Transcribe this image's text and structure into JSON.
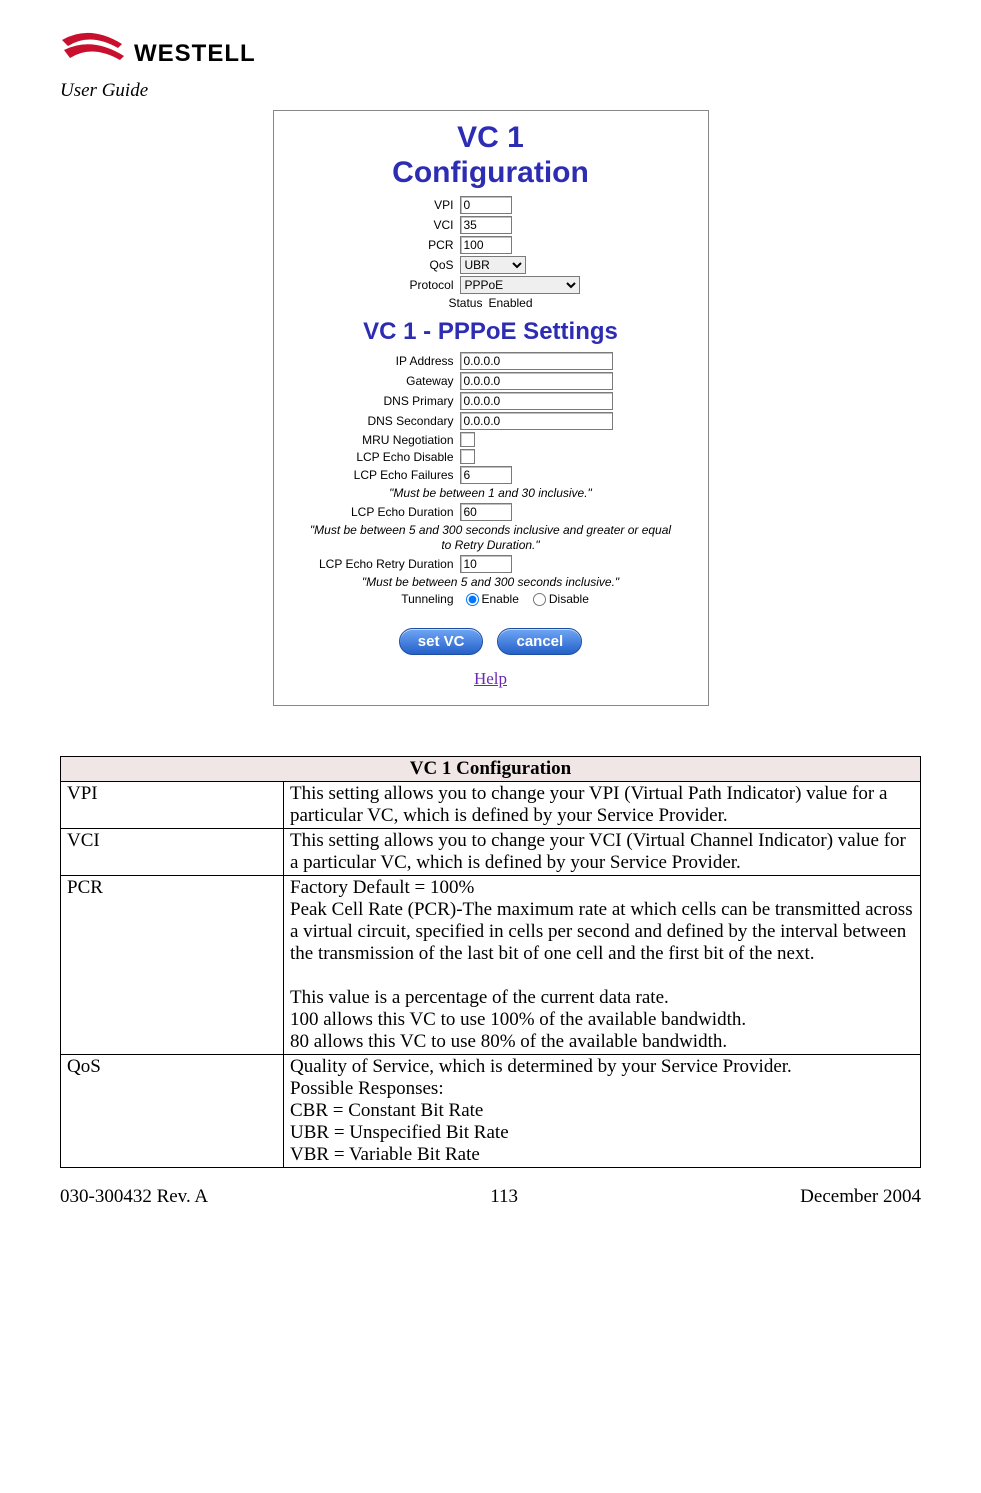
{
  "header": {
    "brand": "WESTELL",
    "guide": "User Guide"
  },
  "screenshot": {
    "title_line1": "VC 1",
    "title_line2": "Configuration",
    "fields": {
      "vpi": {
        "label": "VPI",
        "value": "0"
      },
      "vci": {
        "label": "VCI",
        "value": "35"
      },
      "pcr": {
        "label": "PCR",
        "value": "100"
      },
      "qos": {
        "label": "QoS",
        "value": "UBR"
      },
      "protocol": {
        "label": "Protocol",
        "value": "PPPoE"
      },
      "status_label": "Status",
      "status_value": "Enabled"
    },
    "subtitle": "VC 1 - PPPoE Settings",
    "pppoe": {
      "ip": {
        "label": "IP Address",
        "value": "0.0.0.0"
      },
      "gw": {
        "label": "Gateway",
        "value": "0.0.0.0"
      },
      "dns1": {
        "label": "DNS Primary",
        "value": "0.0.0.0"
      },
      "dns2": {
        "label": "DNS Secondary",
        "value": "0.0.0.0"
      },
      "mru": {
        "label": "MRU Negotiation"
      },
      "echo_disable": {
        "label": "LCP Echo Disable"
      },
      "echo_fail": {
        "label": "LCP Echo Failures",
        "value": "6"
      },
      "hint1": "\"Must be between 1 and 30 inclusive.\"",
      "echo_dur": {
        "label": "LCP Echo Duration",
        "value": "60"
      },
      "hint2": "\"Must be between 5 and 300 seconds inclusive and greater or equal to Retry Duration.\"",
      "retry": {
        "label": "LCP Echo Retry Duration",
        "value": "10"
      },
      "hint3": "\"Must be between 5 and 300 seconds inclusive.\"",
      "tunnel": {
        "label": "Tunneling",
        "enable": "Enable",
        "disable": "Disable"
      }
    },
    "buttons": {
      "set": "set VC",
      "cancel": "cancel"
    },
    "help": "Help"
  },
  "table": {
    "title": "VC 1 Configuration",
    "rows": [
      {
        "k": "VPI",
        "v": "This setting allows you to change your VPI (Virtual Path Indicator) value for a particular VC, which is defined by your Service Provider."
      },
      {
        "k": "VCI",
        "v": "This setting allows you to change your VCI (Virtual Channel Indicator) value for a particular VC, which is defined by your Service Provider."
      },
      {
        "k": "PCR",
        "v": "Factory Default = 100%\nPeak Cell Rate (PCR)-The maximum rate at which cells can be transmitted across a virtual circuit, specified in cells per second and defined by the interval between the transmission of the last bit of one cell and the first bit of the next.\n\nThis value is a percentage of the current data rate.\n100 allows this VC to use 100% of the available bandwidth.\n80 allows this VC to use 80% of the available bandwidth."
      },
      {
        "k": "QoS",
        "v": "Quality of Service, which is determined by your Service Provider.\nPossible Responses:\nCBR = Constant Bit Rate\nUBR = Unspecified Bit Rate\nVBR = Variable Bit Rate"
      }
    ]
  },
  "footer": {
    "left": "030-300432 Rev. A",
    "center": "113",
    "right": "December 2004"
  }
}
